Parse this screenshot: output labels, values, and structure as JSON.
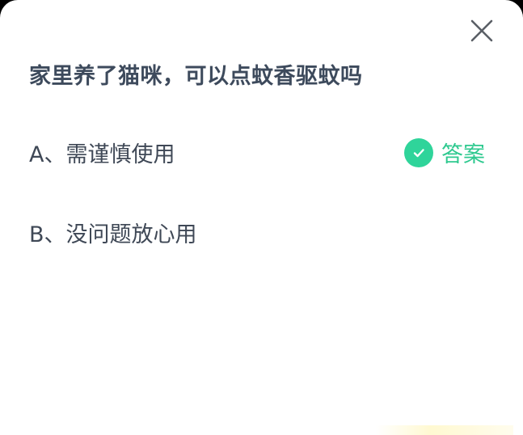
{
  "dialog": {
    "close_icon": "close-icon",
    "question": "家里养了猫咪，可以点蚊香驱蚊吗",
    "options": [
      {
        "label": "A、需谨慎使用",
        "is_answer": true
      },
      {
        "label": "B、没问题放心用",
        "is_answer": false
      }
    ],
    "answer_badge": {
      "icon": "check-circle-icon",
      "label": "答案",
      "color": "#2fd49a"
    }
  }
}
